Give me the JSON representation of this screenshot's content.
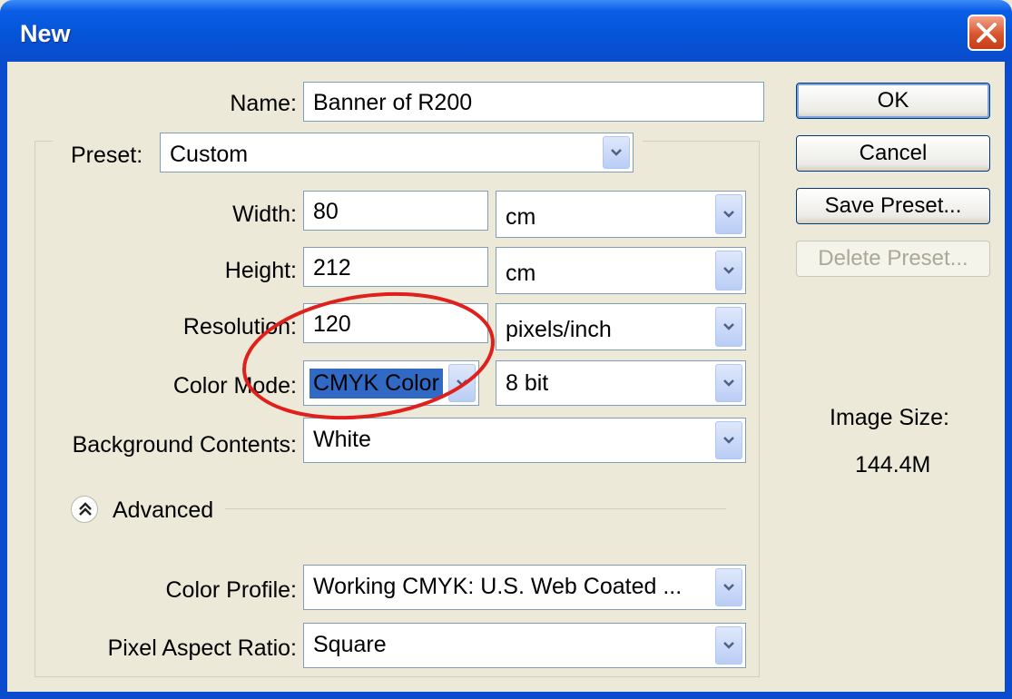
{
  "window": {
    "title": "New"
  },
  "form": {
    "name_label": "Name:",
    "name_value": "Banner of R200",
    "preset_label": "Preset:",
    "preset_value": "Custom",
    "width_label": "Width:",
    "width_value": "80",
    "width_unit": "cm",
    "height_label": "Height:",
    "height_value": "212",
    "height_unit": "cm",
    "resolution_label": "Resolution:",
    "resolution_value": "120",
    "resolution_unit": "pixels/inch",
    "color_mode_label": "Color Mode:",
    "color_mode_value": "CMYK Color",
    "bit_depth_value": "8 bit",
    "background_label": "Background Contents:",
    "background_value": "White",
    "advanced_label": "Advanced",
    "color_profile_label": "Color Profile:",
    "color_profile_value": "Working CMYK:  U.S. Web Coated ...",
    "pixel_aspect_label": "Pixel Aspect Ratio:",
    "pixel_aspect_value": "Square"
  },
  "buttons": {
    "ok": "OK",
    "cancel": "Cancel",
    "save_preset": "Save Preset...",
    "delete_preset": "Delete Preset..."
  },
  "info": {
    "image_size_label": "Image Size:",
    "image_size_value": "144.4M"
  },
  "colors": {
    "title_bar": "#0553d6",
    "dialog_bg": "#ece9d8",
    "annotation_circle": "#e0201c",
    "selection": "#316ac5"
  }
}
